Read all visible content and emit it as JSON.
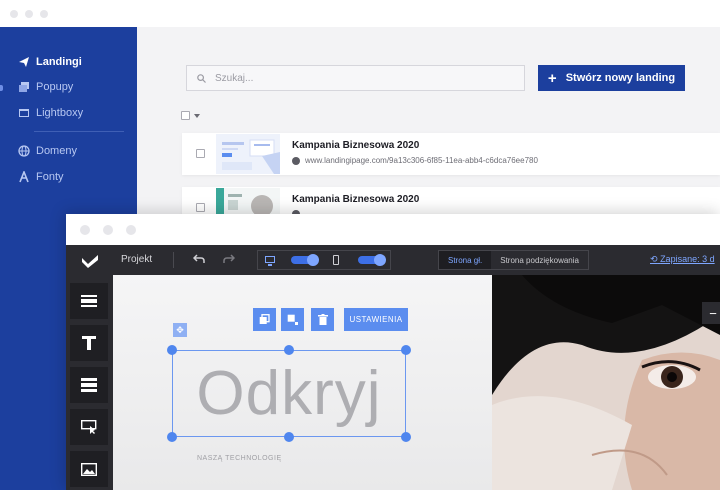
{
  "dashboard": {
    "sidebar": {
      "items": [
        {
          "label": "Landingi",
          "icon": "paper-plane-icon",
          "active": true
        },
        {
          "label": "Popupy",
          "icon": "stacked-windows-icon",
          "active": false
        },
        {
          "label": "Lightboxy",
          "icon": "window-icon",
          "active": false
        },
        {
          "label": "Domeny",
          "icon": "globe-icon",
          "active": false
        },
        {
          "label": "Fonty",
          "icon": "font-icon",
          "active": false
        }
      ]
    },
    "search": {
      "placeholder": "Szukaj..."
    },
    "create_button": {
      "label": "Stwórz nowy landing"
    },
    "landings": [
      {
        "name": "Kampania Biznesowa 2020",
        "url": "www.landingipage.com/9a13c306-6f85-11ea-abb4-c6dca76ee780"
      },
      {
        "name": "Kampania Biznesowa 2020",
        "url": ""
      }
    ]
  },
  "editor": {
    "project_label": "Projekt",
    "page_tabs": [
      {
        "label": "Strona gł.",
        "active": true
      },
      {
        "label": "Strona podziękowania",
        "active": false
      }
    ],
    "saved_label": "Zapisane: 3 d",
    "element_toolbar": {
      "settings_label": "USTAWIENIA"
    },
    "canvas": {
      "headline": "Odkryj",
      "subtitle": "NASZĄ TECHNOLOGIĘ"
    },
    "zoom_label": "−",
    "tools": [
      "section-tool-icon",
      "text-tool-icon",
      "rows-tool-icon",
      "button-tool-icon",
      "image-tool-icon"
    ]
  },
  "colors": {
    "sidebar_bg": "#1c3f9e",
    "primary_button": "#1c3f9e",
    "editor_dark": "#2b2b30",
    "accent_blue": "#5b8def",
    "link_blue": "#7ea6ff"
  }
}
